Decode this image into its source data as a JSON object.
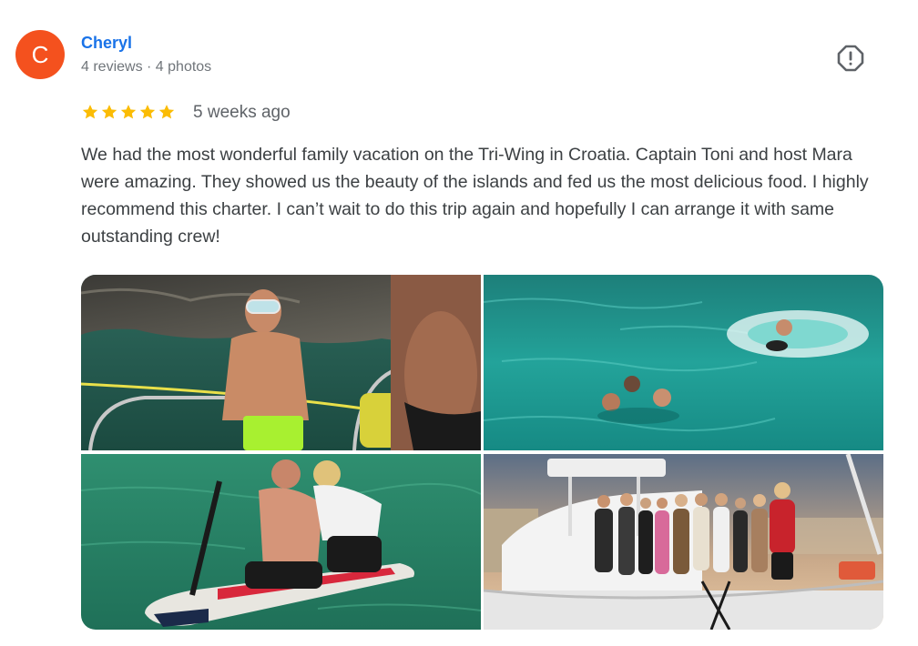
{
  "reviewer": {
    "initial": "C",
    "name": "Cheryl",
    "meta": "4 reviews · 4 photos",
    "avatar_color": "#f4511e"
  },
  "flag_icon": "report-flag-icon",
  "rating": {
    "stars": 5,
    "max": 5,
    "star_color": "#fbbc04",
    "time_ago": "5 weeks ago"
  },
  "review_text": "We had the most wonderful family vacation on the Tri-Wing in Croatia. Captain Toni and host Mara were amazing. They showed us the beauty of the islands and fed us the most delicious food. I highly recommend this charter. I can’t wait to do this trip again and hopefully I can arrange it with same outstanding crew!",
  "photos": [
    {
      "name": "photo-snorkel-man-on-boat"
    },
    {
      "name": "photo-swimmers-in-turquoise-water"
    },
    {
      "name": "photo-paddleboard-two-men"
    },
    {
      "name": "photo-group-on-catamaran"
    }
  ],
  "colors": {
    "name_link": "#1a73e8",
    "meta": "#70757a",
    "text": "#3c4043"
  }
}
